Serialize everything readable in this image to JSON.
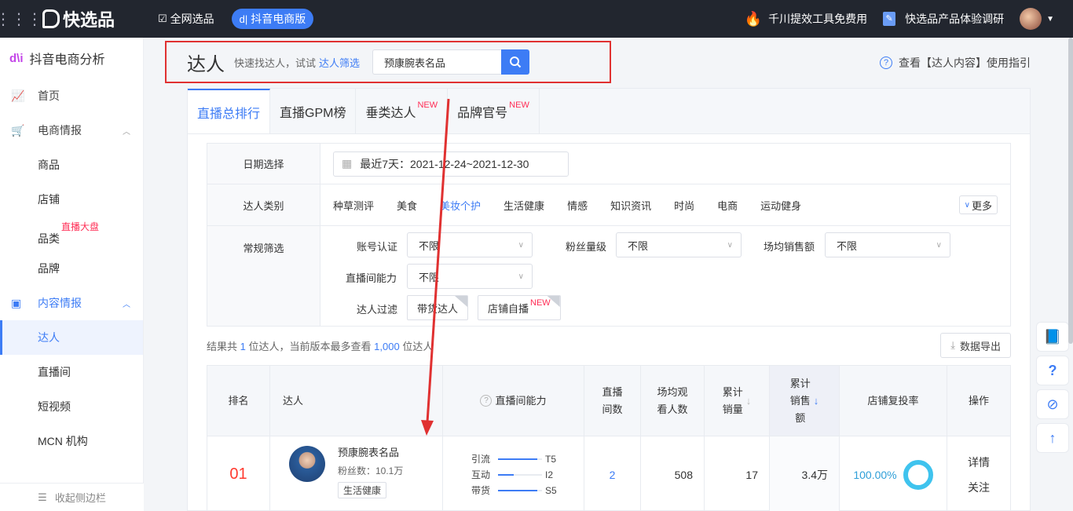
{
  "topbar": {
    "logo": "快选品",
    "tabs": [
      {
        "label": "全网选品",
        "active": false
      },
      {
        "label": "抖音电商版",
        "active": true
      }
    ],
    "promo": "千川提效工具免费用",
    "survey": "快选品产品体验调研"
  },
  "sidebar": {
    "title": "抖音电商分析",
    "home": "首页",
    "ecom": "电商情报",
    "ecom_items": [
      "商品",
      "店铺",
      "品类",
      "品牌"
    ],
    "hot_badge": "直播大盘",
    "content": "内容情报",
    "content_items": [
      "达人",
      "直播间",
      "短视频",
      "MCN 机构"
    ],
    "collapse": "收起侧边栏"
  },
  "header": {
    "title": "达人",
    "tip": "快速找达人，试试",
    "tip_link": "达人筛选",
    "search_value": "预康腕表名品",
    "guide": "查看【达人内容】使用指引"
  },
  "tabs": [
    {
      "label": "直播总排行",
      "new": ""
    },
    {
      "label": "直播GPM榜",
      "new": ""
    },
    {
      "label": "垂类达人",
      "new": "NEW"
    },
    {
      "label": "品牌官号",
      "new": "NEW"
    }
  ],
  "filters": {
    "date_label": "日期选择",
    "date_value": "最近7天：2021-12-24~2021-12-30",
    "category_label": "达人类别",
    "categories": [
      "种草测评",
      "美食",
      "美妆个护",
      "生活健康",
      "情感",
      "知识资讯",
      "时尚",
      "电商",
      "运动健身"
    ],
    "active_category": "美妆个护",
    "more": "更多",
    "general_label": "常规筛选",
    "account_label": "账号认证",
    "account_value": "不限",
    "fans_label": "粉丝量级",
    "fans_value": "不限",
    "sales_label": "场均销售额",
    "sales_value": "不限",
    "room_label": "直播间能力",
    "room_value": "不限",
    "filter_label": "达人过滤",
    "chip1": "带货达人",
    "chip2": "店铺自播",
    "chip2_new": "NEW"
  },
  "result": {
    "prefix": "结果共",
    "count": "1",
    "mid": "位达人，当前版本最多查看",
    "max": "1,000",
    "suffix": "位达人",
    "export": "数据导出"
  },
  "table": {
    "headers": {
      "rank": "排名",
      "person": "达人",
      "ability": "直播间能力",
      "live1": "直播",
      "live2": "间数",
      "view1": "场均观",
      "view2": "看人数",
      "sold1": "累计",
      "sold2": "销量",
      "sales1": "累计",
      "sales2": "销售",
      "sales3": "额",
      "repurchase": "店铺复投率",
      "ops": "操作"
    },
    "rows": [
      {
        "rank": "01",
        "name": "预康腕表名品",
        "fans": "粉丝数：10.1万",
        "tag": "生活健康",
        "ability": [
          {
            "name": "引流",
            "level": "T5",
            "fill": 0.9
          },
          {
            "name": "互动",
            "level": "I2",
            "fill": 0.35
          },
          {
            "name": "带货",
            "level": "S5",
            "fill": 0.9
          }
        ],
        "live_count": "2",
        "avg_viewers": "508",
        "total_sold": "17",
        "total_sales": "3.4万",
        "repurchase": "100.00%",
        "op1": "详情",
        "op2": "关注"
      }
    ]
  },
  "colors": {
    "accent": "#3d7cf5",
    "rank": "#ff3b30",
    "new": "#ff2d55",
    "annotation": "#e03131"
  }
}
